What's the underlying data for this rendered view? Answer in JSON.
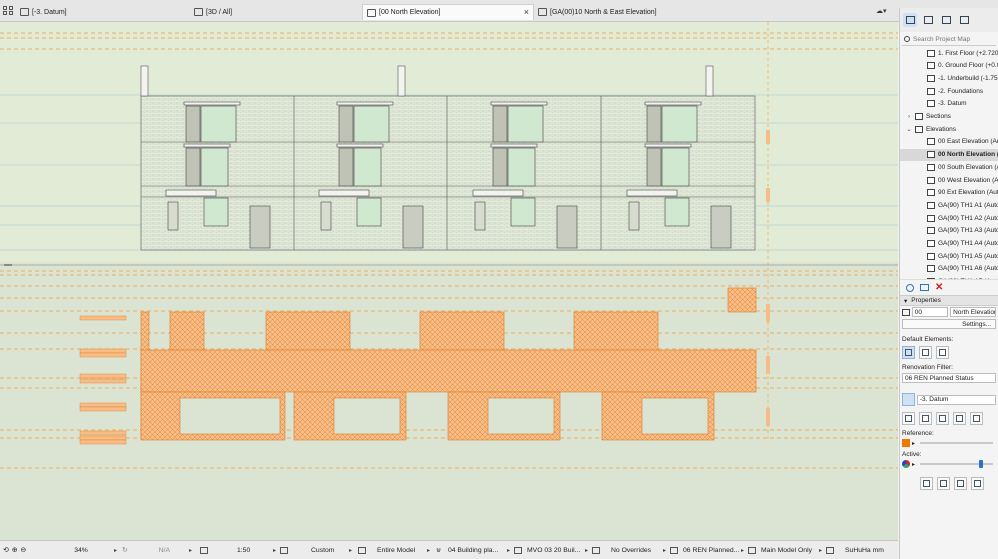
{
  "tabs": [
    {
      "label": "[-3. Datum]"
    },
    {
      "label": "[3D / All]"
    },
    {
      "label": "[00 North Elevation]",
      "close": "×"
    },
    {
      "label": "[GA(00)10 North & East Elevation]"
    }
  ],
  "navigator": {
    "search_placeholder": "Search Project Map",
    "items": [
      {
        "label": "1. First Floor (+2.720",
        "indent": 3,
        "icon": "story-icon"
      },
      {
        "label": "0. Ground Floor (+0.0",
        "indent": 3,
        "icon": "story-icon"
      },
      {
        "label": "-1. Underbuild (-1.75",
        "indent": 3,
        "icon": "story-icon"
      },
      {
        "label": "-2. Foundations",
        "indent": 3,
        "icon": "story-icon"
      },
      {
        "label": "-3. Datum",
        "indent": 3,
        "icon": "story-icon"
      },
      {
        "label": "Sections",
        "indent": 1,
        "icon": "folder-icon",
        "caret": "›"
      },
      {
        "label": "Elevations",
        "indent": 1,
        "icon": "folder-icon",
        "caret": "⌄"
      },
      {
        "label": "00 East Elevation (Au",
        "indent": 3,
        "icon": "elevation-icon"
      },
      {
        "label": "00 North Elevation (A",
        "indent": 3,
        "icon": "elevation-icon",
        "selected": true
      },
      {
        "label": "00 South Elevation (A",
        "indent": 3,
        "icon": "elevation-icon"
      },
      {
        "label": "00 West Elevation (Au",
        "indent": 3,
        "icon": "elevation-icon"
      },
      {
        "label": "90 Ext Elevation (Auto",
        "indent": 3,
        "icon": "elevation-icon"
      },
      {
        "label": "GA(90) TH1 A1 (Auto-",
        "indent": 3,
        "icon": "elevation-icon"
      },
      {
        "label": "GA(90) TH1 A2 (Auto-",
        "indent": 3,
        "icon": "elevation-icon"
      },
      {
        "label": "GA(90) TH1 A3 (Auto-",
        "indent": 3,
        "icon": "elevation-icon"
      },
      {
        "label": "GA(90) TH1 A4 (Auto-",
        "indent": 3,
        "icon": "elevation-icon"
      },
      {
        "label": "GA(90) TH1 A5 (Auto-",
        "indent": 3,
        "icon": "elevation-icon"
      },
      {
        "label": "GA(90) TH1 A6 (Auto-",
        "indent": 3,
        "icon": "elevation-icon"
      },
      {
        "label": "GA(90) TH1 A7 (Auto-",
        "indent": 3,
        "icon": "elevation-icon"
      }
    ]
  },
  "properties": {
    "header": "Properties",
    "id_value": "00",
    "name_value": "North Elevation",
    "settings_label": "Settings...",
    "default_elements_label": "Default Elements:",
    "renovation_filter_label": "Renovation Filter:",
    "renovation_filter_value": "06 REN Planned Status",
    "story_value": "-3. Datum",
    "reference_label": "Reference:",
    "active_label": "Active:",
    "reference_color": "#f07800"
  },
  "statusbar": {
    "zoom": "34%",
    "angle": "N/A",
    "scale": "1:50",
    "pen_set": "Custom",
    "model_scope": "Entire Model",
    "layer_combo": "04 Building pla...",
    "model_view": "MVO 03 20 Buil...",
    "overrides": "No Overrides",
    "renovation": "06 REN Planned...",
    "view_only": "Main Model Only",
    "dimension": "SuHuHa mm"
  },
  "colors": {
    "canvas_bg": "#e2ebd8",
    "hatch_orange": "#f4a55a",
    "dash_orange": "#f29a3a",
    "glazing": "#cfe8cf",
    "selection_blue": "#cfe0f3"
  }
}
